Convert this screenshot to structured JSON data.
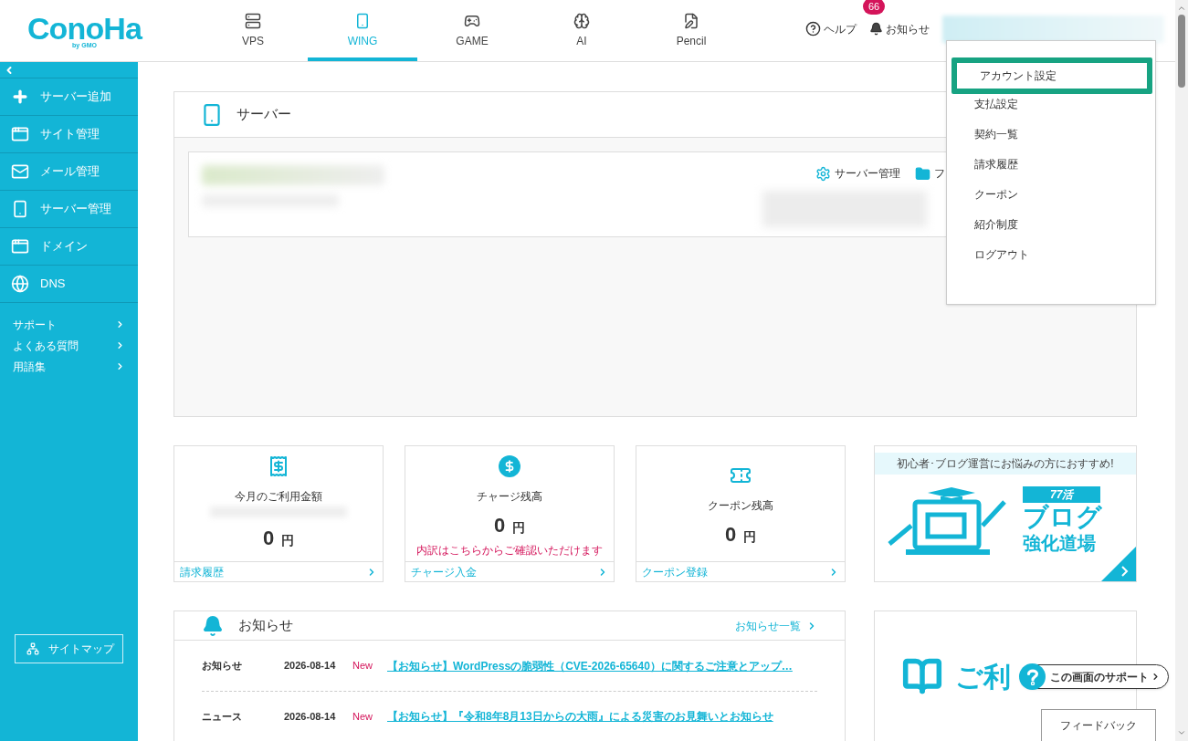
{
  "header": {
    "logo": "ConoHa",
    "logo_sub": "by GMO",
    "nav": [
      {
        "label": "VPS",
        "kind": "server",
        "selected": false
      },
      {
        "label": "WING",
        "kind": "wing",
        "selected": true
      },
      {
        "label": "GAME",
        "kind": "game",
        "selected": false
      },
      {
        "label": "AI",
        "kind": "ai",
        "selected": false
      },
      {
        "label": "Pencil",
        "kind": "pencil",
        "selected": false
      }
    ],
    "help": "ヘルプ",
    "notices": "お知らせ",
    "notice_count": "66"
  },
  "sidebar": {
    "items": [
      {
        "label": "サーバー追加",
        "kind": "plus"
      },
      {
        "label": "サイト管理",
        "kind": "site"
      },
      {
        "label": "メール管理",
        "kind": "mail"
      },
      {
        "label": "サーバー管理",
        "kind": "server"
      },
      {
        "label": "ドメイン",
        "kind": "domain"
      },
      {
        "label": "DNS",
        "kind": "dns"
      }
    ],
    "links": [
      "サポート",
      "よくある質問",
      "用語集"
    ],
    "sitemap": "サイトマップ"
  },
  "account_menu": [
    {
      "label": "アカウント設定",
      "selected": true
    },
    {
      "label": "支払設定",
      "selected": false
    },
    {
      "label": "契約一覧",
      "selected": false
    },
    {
      "label": "請求履歴",
      "selected": false
    },
    {
      "label": "クーポン",
      "selected": false
    },
    {
      "label": "紹介制度",
      "selected": false
    },
    {
      "label": "ログアウト",
      "selected": false
    }
  ],
  "server_panel": {
    "title": "サーバー",
    "actions": [
      {
        "label": "サーバー管理",
        "kind": "gear"
      },
      {
        "label": "フ",
        "kind": "folder"
      }
    ]
  },
  "stats": [
    {
      "title": "今月のご利用金額",
      "amount": "0",
      "unit": "円",
      "link": "請求履歴",
      "kind": "receipt"
    },
    {
      "title": "チャージ残高",
      "amount": "0",
      "unit": "円",
      "note": "内訳はこちらからご確認いただけます",
      "link": "チャージ入金",
      "kind": "dollar"
    },
    {
      "title": "クーポン残高",
      "amount": "0",
      "unit": "円",
      "link": "クーポン登録",
      "kind": "coupon"
    }
  ],
  "blog_banner": {
    "tagline": "初心者･ブログ運営にお悩みの方におすすめ!",
    "badge": "77活",
    "title": "ブログ",
    "subtitle": "強化道場"
  },
  "news": {
    "title": "お知らせ",
    "more": "お知らせ一覧",
    "rows": [
      {
        "category": "お知らせ",
        "date": "2026-08-14",
        "badge": "New",
        "title": "【お知らせ】WordPressの脆弱性（CVE-2026-65640）に関するご注意とアップ…"
      },
      {
        "category": "ニュース",
        "date": "2026-08-14",
        "badge": "New",
        "title": "【お知らせ】『令和8年8月13日からの大雨』による災害のお見舞いとお知らせ"
      }
    ]
  },
  "guide_banner": {
    "title": "ご利"
  },
  "support_button": "この画面のサポート",
  "feedback": "フィードバック"
}
